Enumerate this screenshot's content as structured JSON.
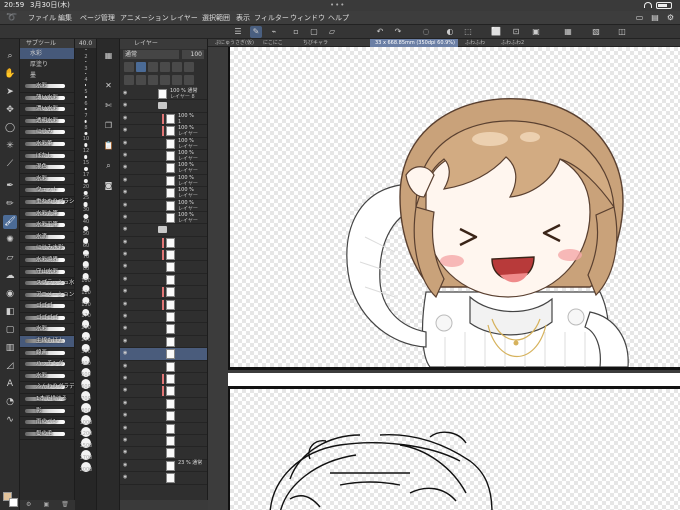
{
  "status_bar": {
    "time": "20:59",
    "date": "3月30日(木)"
  },
  "menu": {
    "items": [
      "ファイル",
      "編集",
      "ページ管理",
      "アニメーション",
      "レイヤー",
      "選択範囲",
      "表示",
      "フィルター",
      "ウィンドウ",
      "ヘルプ"
    ]
  },
  "subtool_panel": {
    "header": "サブツール",
    "categories": [
      "水彩",
      "厚塗り",
      "墨"
    ],
    "brushes": [
      "水彩",
      "薄い水彩",
      "濃い水彩",
      "透明水彩",
      "にじみ",
      "水彩筆",
      "ぼかし",
      "混色",
      "水彩",
      "ウェット",
      "重ねぬりブラシ",
      "水彩丸筆",
      "水彩平筆",
      "水滴",
      "にじみ水彩",
      "水彩境界",
      "守山水彩",
      "スプラッシュ水彩",
      "アニメーション",
      "ゴゴゴ",
      "ゴゴゴゴ",
      "水彩",
      "主線もほん",
      "線画",
      "ハッチング",
      "水彩",
      "ふんわりグラデーション",
      "1本で描ける",
      "影",
      "雨のペン",
      "髪の毛"
    ],
    "selected_brush_index": 22
  },
  "size_panel": {
    "header": "40.0",
    "sizes": [
      "2",
      "3",
      "4",
      "5",
      "6",
      "7",
      "8",
      "10",
      "12",
      "15",
      "17",
      "20",
      "25",
      "30",
      "40",
      "50",
      "60",
      "70",
      "80",
      "100",
      "120",
      "150",
      "170",
      "200",
      "250",
      "300",
      "400",
      "500",
      "600",
      "700",
      "800",
      "1000",
      "1200",
      "1500",
      "1700",
      "2000"
    ]
  },
  "layer_panel": {
    "tab_label": "レイヤー",
    "blend_mode": "通常",
    "opacity": "100",
    "layers": [
      {
        "pct": "100 % 通常",
        "name": "レイヤー 8",
        "type": "layer",
        "flag": false,
        "selected": false
      },
      {
        "pct": "",
        "name": "",
        "type": "folder",
        "flag": false,
        "selected": false
      },
      {
        "pct": "100 %",
        "name": "1",
        "type": "layer",
        "flag": true,
        "selected": false
      },
      {
        "pct": "100 %",
        "name": "レイヤー",
        "type": "layer",
        "flag": true,
        "selected": false
      },
      {
        "pct": "100 %",
        "name": "レイヤー",
        "type": "layer",
        "flag": false,
        "selected": false
      },
      {
        "pct": "100 %",
        "name": "レイヤー",
        "type": "layer",
        "flag": false,
        "selected": false
      },
      {
        "pct": "100 %",
        "name": "レイヤー",
        "type": "layer",
        "flag": false,
        "selected": false
      },
      {
        "pct": "100 %",
        "name": "レイヤー",
        "type": "layer",
        "flag": false,
        "selected": false
      },
      {
        "pct": "100 %",
        "name": "レイヤー",
        "type": "layer",
        "flag": false,
        "selected": false
      },
      {
        "pct": "100 %",
        "name": "レイヤー",
        "type": "layer",
        "flag": false,
        "selected": false
      },
      {
        "pct": "100 %",
        "name": "レイヤー",
        "type": "layer",
        "flag": false,
        "selected": false
      },
      {
        "pct": "",
        "name": "",
        "type": "folder",
        "flag": false,
        "selected": false
      },
      {
        "pct": "",
        "name": "",
        "type": "layer",
        "flag": true,
        "selected": false
      },
      {
        "pct": "",
        "name": "",
        "type": "layer",
        "flag": true,
        "selected": false
      },
      {
        "pct": "",
        "name": "",
        "type": "layer",
        "flag": false,
        "selected": false
      },
      {
        "pct": "",
        "name": "",
        "type": "layer",
        "flag": false,
        "selected": false
      },
      {
        "pct": "",
        "name": "",
        "type": "layer",
        "flag": true,
        "selected": false
      },
      {
        "pct": "",
        "name": "",
        "type": "layer",
        "flag": true,
        "selected": false
      },
      {
        "pct": "",
        "name": "",
        "type": "layer",
        "flag": false,
        "selected": false
      },
      {
        "pct": "",
        "name": "",
        "type": "layer",
        "flag": false,
        "selected": false
      },
      {
        "pct": "",
        "name": "",
        "type": "layer",
        "flag": false,
        "selected": false
      },
      {
        "pct": "",
        "name": "",
        "type": "layer",
        "flag": false,
        "selected": true
      },
      {
        "pct": "",
        "name": "",
        "type": "layer",
        "flag": false,
        "selected": false
      },
      {
        "pct": "",
        "name": "",
        "type": "layer",
        "flag": true,
        "selected": false
      },
      {
        "pct": "",
        "name": "",
        "type": "layer",
        "flag": true,
        "selected": false
      },
      {
        "pct": "",
        "name": "",
        "type": "layer",
        "flag": false,
        "selected": false
      },
      {
        "pct": "",
        "name": "",
        "type": "layer",
        "flag": false,
        "selected": false
      },
      {
        "pct": "",
        "name": "",
        "type": "layer",
        "flag": false,
        "selected": false
      },
      {
        "pct": "",
        "name": "",
        "type": "layer",
        "flag": false,
        "selected": false
      },
      {
        "pct": "",
        "name": "",
        "type": "layer",
        "flag": false,
        "selected": false
      },
      {
        "pct": "23 % 通常",
        "name": "",
        "type": "layer",
        "flag": false,
        "selected": false
      },
      {
        "pct": "",
        "name": "",
        "type": "layer",
        "flag": false,
        "selected": false
      }
    ]
  },
  "canvas": {
    "tabs": [
      {
        "label": "ぷにゅうさぎ(仮)",
        "active": false
      },
      {
        "label": "にこにこ",
        "active": false
      },
      {
        "label": "ちびキャラ",
        "active": false
      },
      {
        "label": "33 x 668.85mm (350dpi 60.9%)",
        "active": true
      },
      {
        "label": "ふわふわ",
        "active": false
      },
      {
        "label": "ふわふわ2",
        "active": false
      }
    ]
  },
  "colors": {
    "main_color": "#e2c39b",
    "sub_color": "#ffffff",
    "accent": "#4b6b96",
    "hair": "#c9a27a",
    "flag": "#e07575"
  }
}
